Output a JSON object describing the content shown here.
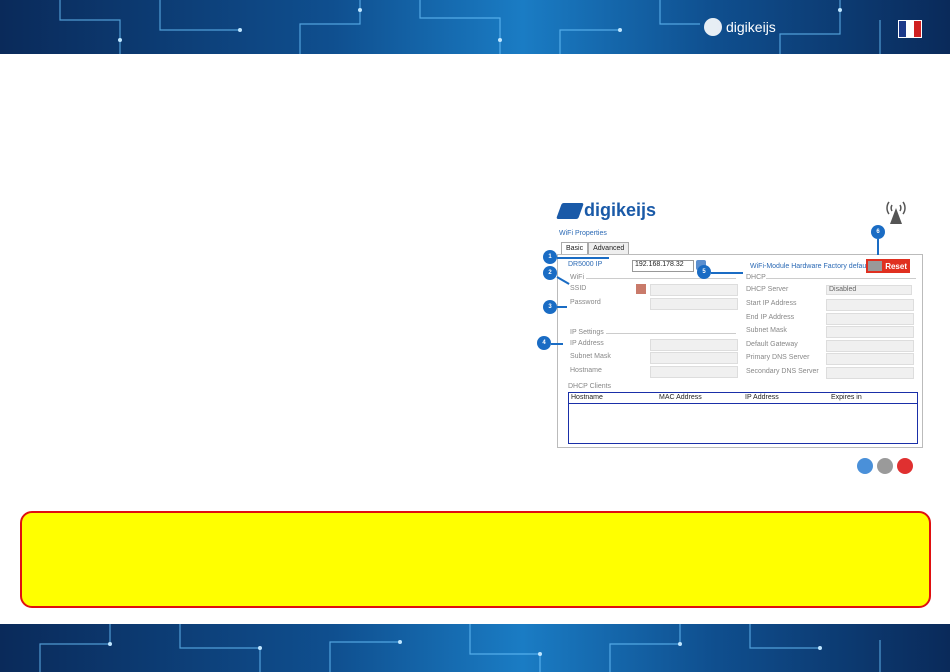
{
  "header": {
    "brand": "digikeijs",
    "flag": [
      "#1d3a8a",
      "#ffffff",
      "#d02020"
    ]
  },
  "screenshot": {
    "logo": "digikeijs",
    "title": "WiFi Properties",
    "tabs": [
      {
        "label": "Basic"
      },
      {
        "label": "Advanced"
      }
    ],
    "dr_label": "DR5000 IP",
    "dr_ip": "192.168.178.32",
    "wifi_group": "WiFi",
    "ssid_label": "SSID",
    "password_label": "Password",
    "ip_settings_group": "IP Settings",
    "ip_labels": [
      "IP Address",
      "Subnet Mask",
      "Hostname"
    ],
    "factory_text": "WiFi-Module Hardware Factory defaults",
    "reset_label": "Reset",
    "dhcp_group": "DHCP",
    "dhcp_server_label": "DHCP Server",
    "dhcp_server_value": "Disabled",
    "dhcp_labels": [
      "Start IP Address",
      "End IP Address",
      "Subnet Mask",
      "Default Gateway",
      "Primary DNS Server",
      "Secondary DNS Server"
    ],
    "clients_group": "DHCP Clients",
    "client_columns": [
      "Hostname",
      "MAC Address",
      "IP Address",
      "Expires in"
    ],
    "markers": [
      "1",
      "2",
      "3",
      "4",
      "5",
      "6"
    ]
  },
  "colors": {
    "note_bg": "#ffff00",
    "note_border": "#e01010",
    "accent": "#1a6cc4"
  }
}
